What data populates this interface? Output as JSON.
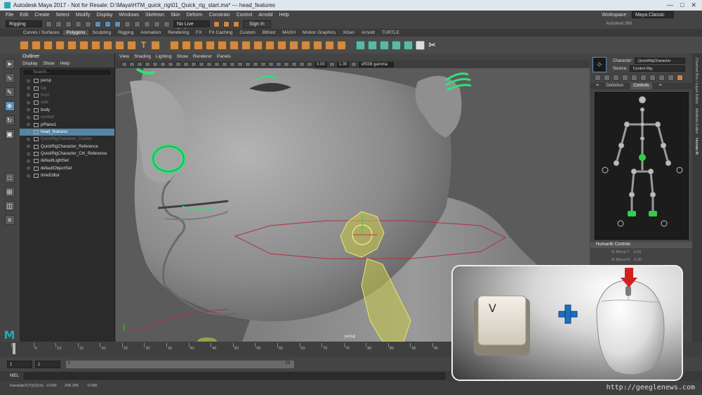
{
  "window": {
    "title": "Autodesk Maya 2017 - Not for Resale: D:\\Maya\\HTM_quick_rig\\01_Quick_rig_start.ma* --- head_features"
  },
  "menubar": {
    "items": [
      "File",
      "Edit",
      "Create",
      "Select",
      "Modify",
      "Display",
      "Windows",
      "Skeleton",
      "Skin",
      "Deform",
      "Constrain",
      "Control",
      "Arnold",
      "Help"
    ],
    "workspace_label": "Workspace :",
    "workspace_value": "Maya Classic"
  },
  "statusline": {
    "menu_set": "Rigging",
    "live_surface": "No Live Surface",
    "sign_in": "Sign In",
    "autodesk_label": "Autodesk 360"
  },
  "shelf": {
    "tabs": [
      "Curves / Surfaces",
      "Polygons",
      "Sculpting",
      "Rigging",
      "Animation",
      "Rendering",
      "FX",
      "FX Caching",
      "Custom",
      "Bifrost",
      "MASH",
      "Motion Graphics",
      "XGen",
      "Arnold",
      "TURTLE"
    ],
    "active_tab": "Polygons"
  },
  "outliner": {
    "title": "Outliner",
    "menu": [
      "Display",
      "Show",
      "Help"
    ],
    "search_placeholder": "Search...",
    "items": [
      {
        "label": "persp",
        "dim": false,
        "sel": false
      },
      {
        "label": "top",
        "dim": true,
        "sel": false
      },
      {
        "label": "front",
        "dim": true,
        "sel": false
      },
      {
        "label": "side",
        "dim": true,
        "sel": false
      },
      {
        "label": "body",
        "dim": false,
        "sel": false
      },
      {
        "label": "eyeball",
        "dim": true,
        "sel": false
      },
      {
        "label": "pPlane1",
        "dim": false,
        "sel": false
      },
      {
        "label": "head_features",
        "dim": false,
        "sel": true
      },
      {
        "label": "QuickRigCharacter_Guides",
        "dim": true,
        "sel": false
      },
      {
        "label": "QuickRigCharacter_Reference",
        "dim": false,
        "sel": false
      },
      {
        "label": "QuickRigCharacter_Ctrl_Reference",
        "dim": false,
        "sel": false
      },
      {
        "label": "defaultLightSet",
        "dim": false,
        "sel": false
      },
      {
        "label": "defaultObjectSet",
        "dim": false,
        "sel": false
      },
      {
        "label": "timeEditor",
        "dim": false,
        "sel": false
      }
    ]
  },
  "viewport": {
    "menu": [
      "View",
      "Shading",
      "Lighting",
      "Show",
      "Renderer",
      "Panels"
    ],
    "value_1": "0.00",
    "value_2": "1.00",
    "color_space": "sRGB gamma",
    "camera_label": "persp"
  },
  "hik": {
    "character_label": "Character:",
    "character_value": "QuickRigCharacter",
    "source_label": "Source:",
    "source_value": "Control Rig",
    "tabs": [
      "Definition",
      "Controls"
    ],
    "active_tab": "Controls",
    "controls_header": "HumanIK Controls",
    "blend_t": "IK Blend T",
    "blend_r": "IK Blend R",
    "blend_t_value": "0.00",
    "blend_r_value": "0.00",
    "side_tabs": [
      "Channel Box / Layer Editor",
      "Attribute Editor",
      "Human IK"
    ]
  },
  "timeline": {
    "ticks": [
      "1",
      "5",
      "10",
      "15",
      "20",
      "25",
      "30",
      "35",
      "40",
      "45",
      "50",
      "55",
      "60",
      "65",
      "70",
      "75",
      "80",
      "85",
      "90",
      "95"
    ]
  },
  "range": {
    "start": "1",
    "anim_start": "1",
    "range_start": "1",
    "range_end": "24"
  },
  "cmdline": {
    "lang": "MEL"
  },
  "helpline": {
    "text": "translateX(Y)(Z)(m):",
    "x": "-0.000",
    "y": "208.285",
    "z": "-0.585"
  },
  "overlay": {
    "key_label": "V",
    "plus": "+"
  },
  "watermark": "http://geeglenews.com",
  "colors": {
    "accent_blue": "#5285a6",
    "shelf_orange": "#d38a3e",
    "control_green": "#33e07a",
    "hik_green": "#2fd04a",
    "plus_blue": "#1f6fc0"
  }
}
